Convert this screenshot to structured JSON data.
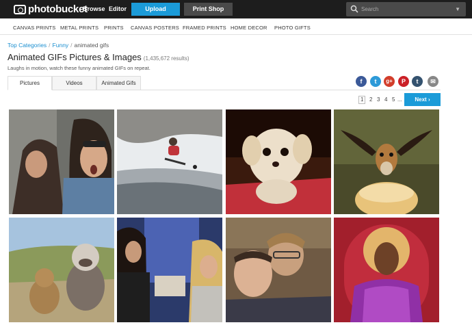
{
  "header": {
    "logo": "photobucket",
    "nav": [
      "Browse",
      "Editor"
    ],
    "upload_label": "Upload",
    "print_label": "Print Shop",
    "search_placeholder": "Search"
  },
  "categories": [
    "CANVAS PRINTS",
    "METAL PRINTS",
    "PRINTS",
    "CANVAS POSTERS",
    "FRAMED PRINTS",
    "HOME DECOR",
    "PHOTO GIFTS"
  ],
  "breadcrumb": {
    "items": [
      "Top Categories",
      "Funny"
    ],
    "current": "animated gifs"
  },
  "page": {
    "title": "Animated GIFs Pictures & Images",
    "count": "(1,435,672 results)",
    "subtitle": "Laughs in motion, watch these funny animated GIFs on repeat."
  },
  "tabs": [
    "Pictures",
    "Videos",
    "Animated Gifs"
  ],
  "share": {
    "icons": [
      "facebook-icon",
      "twitter-icon",
      "google-plus-icon",
      "pinterest-icon",
      "tumblr-icon",
      "email-icon"
    ],
    "colors": [
      "#3b5998",
      "#2d9ad8",
      "#d23e2b",
      "#cb2027",
      "#34526f",
      "#888888"
    ]
  },
  "pagination": {
    "pages": [
      "1",
      "2",
      "3",
      "4",
      "5",
      "..."
    ],
    "current": "1",
    "next_label": "Next ›"
  },
  "colors": {
    "accent": "#1b9bd8",
    "topbar": "#1d1d1d"
  }
}
